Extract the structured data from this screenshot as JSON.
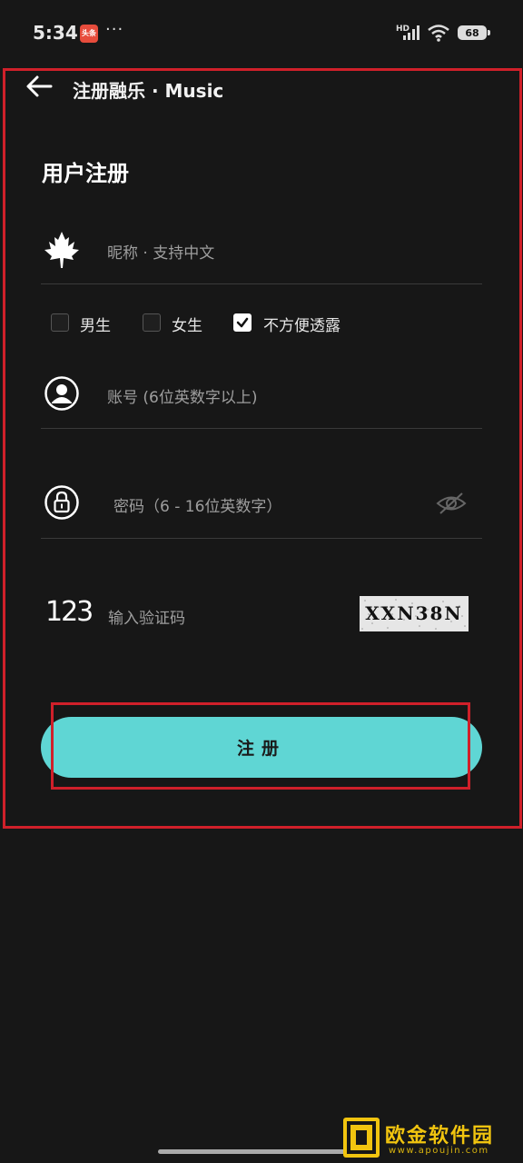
{
  "status_bar": {
    "time": "5:34",
    "app_icon_label": "头条",
    "more_indicator": "···",
    "hd_label": "HD",
    "battery": "68"
  },
  "header": {
    "title": "注册融乐 · Music",
    "back_icon": "arrow-left-icon"
  },
  "form": {
    "title": "用户注册",
    "nickname_placeholder": "昵称 · 支持中文",
    "gender_options": [
      {
        "label": "男生",
        "checked": false
      },
      {
        "label": "女生",
        "checked": false
      },
      {
        "label": "不方便透露",
        "checked": true
      }
    ],
    "account_placeholder": "账号 (6位英数字以上)",
    "password_placeholder": "密码（6 - 16位英数字）",
    "captcha_placeholder": "输入验证码",
    "captcha_code": "XXN38N",
    "code_icon_text": "123",
    "submit_label": "注册"
  },
  "watermark": {
    "title": "欧金软件园",
    "url": "www.apoujin.com"
  },
  "colors": {
    "background": "#171717",
    "accent": "#5fd6d4",
    "annotation": "#d0202a",
    "watermark": "#f1c40f"
  }
}
